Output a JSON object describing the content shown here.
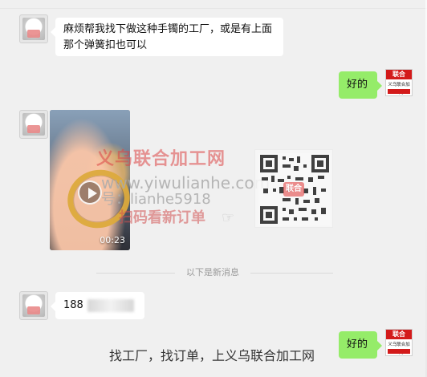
{
  "messages": {
    "m1_text": "麻烦帮我找下做这种手镯的工厂，或是有上面那个弹簧扣也可以",
    "reply_1": "好的",
    "video_duration": "00:23",
    "divider": "以下是新消息",
    "phone_visible": "188",
    "reply_2": "好的"
  },
  "watermark": {
    "title": "义乌联合加工网",
    "url": "www.yiwulianhe.com",
    "id": "号：lianhe5918",
    "scan": "扫码看新订单",
    "hand": "☞",
    "qr_center": "联合"
  },
  "logo": {
    "top": "联合",
    "middle": "义乌联合加工网"
  },
  "footer": {
    "text": "找工厂，找订单，上义乌联合加工网"
  },
  "icons": {
    "play": "play-icon",
    "avatar": "user-avatar-icon"
  }
}
